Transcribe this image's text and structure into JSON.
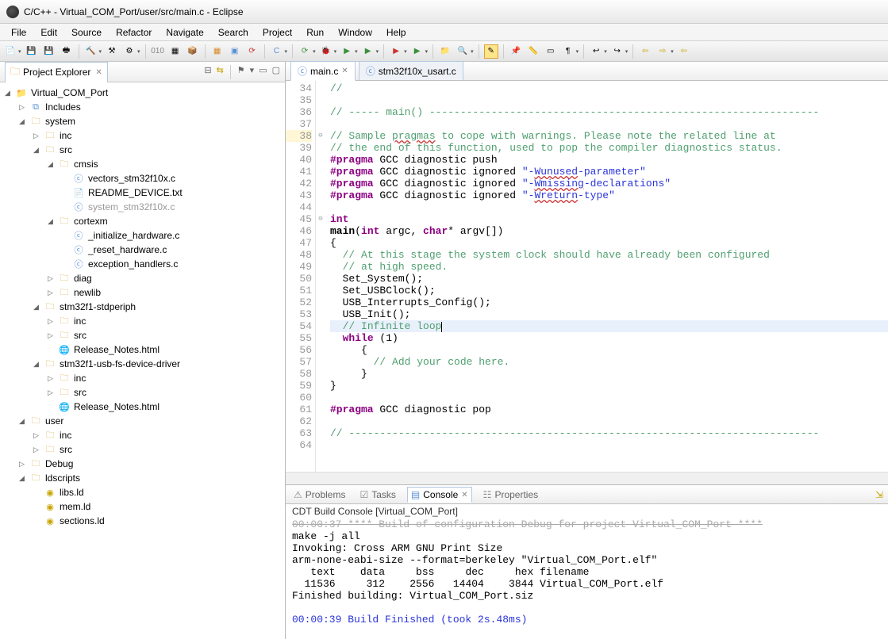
{
  "window": {
    "title": "C/C++ - Virtual_COM_Port/user/src/main.c - Eclipse"
  },
  "menu": [
    "File",
    "Edit",
    "Source",
    "Refactor",
    "Navigate",
    "Search",
    "Project",
    "Run",
    "Window",
    "Help"
  ],
  "project_explorer": {
    "label": "Project Explorer",
    "tree": [
      {
        "d": 0,
        "t": "open",
        "i": "proj",
        "n": "Virtual_COM_Port"
      },
      {
        "d": 1,
        "t": "closed",
        "i": "inc",
        "n": "Includes"
      },
      {
        "d": 1,
        "t": "open",
        "i": "folder",
        "n": "system"
      },
      {
        "d": 2,
        "t": "closed",
        "i": "folder",
        "n": "inc"
      },
      {
        "d": 2,
        "t": "open",
        "i": "folder",
        "n": "src"
      },
      {
        "d": 3,
        "t": "open",
        "i": "folder",
        "n": "cmsis"
      },
      {
        "d": 4,
        "t": "leaf",
        "i": "c",
        "n": "vectors_stm32f10x.c"
      },
      {
        "d": 4,
        "t": "leaf",
        "i": "txt",
        "n": "README_DEVICE.txt"
      },
      {
        "d": 4,
        "t": "leaf",
        "i": "c",
        "n": "system_stm32f10x.c",
        "dim": true
      },
      {
        "d": 3,
        "t": "open",
        "i": "folder",
        "n": "cortexm"
      },
      {
        "d": 4,
        "t": "leaf",
        "i": "c",
        "n": "_initialize_hardware.c"
      },
      {
        "d": 4,
        "t": "leaf",
        "i": "c",
        "n": "_reset_hardware.c"
      },
      {
        "d": 4,
        "t": "leaf",
        "i": "c",
        "n": "exception_handlers.c"
      },
      {
        "d": 3,
        "t": "closed",
        "i": "folder",
        "n": "diag"
      },
      {
        "d": 3,
        "t": "closed",
        "i": "folder",
        "n": "newlib"
      },
      {
        "d": 2,
        "t": "open",
        "i": "folder",
        "n": "stm32f1-stdperiph"
      },
      {
        "d": 3,
        "t": "closed",
        "i": "folder",
        "n": "inc"
      },
      {
        "d": 3,
        "t": "closed",
        "i": "folder",
        "n": "src"
      },
      {
        "d": 3,
        "t": "leaf",
        "i": "html",
        "n": "Release_Notes.html"
      },
      {
        "d": 2,
        "t": "open",
        "i": "folder",
        "n": "stm32f1-usb-fs-device-driver"
      },
      {
        "d": 3,
        "t": "closed",
        "i": "folder",
        "n": "inc"
      },
      {
        "d": 3,
        "t": "closed",
        "i": "folder",
        "n": "src"
      },
      {
        "d": 3,
        "t": "leaf",
        "i": "html",
        "n": "Release_Notes.html"
      },
      {
        "d": 1,
        "t": "open",
        "i": "folder",
        "n": "user"
      },
      {
        "d": 2,
        "t": "closed",
        "i": "folder",
        "n": "inc"
      },
      {
        "d": 2,
        "t": "closed",
        "i": "folder",
        "n": "src"
      },
      {
        "d": 1,
        "t": "closed",
        "i": "folder",
        "n": "Debug"
      },
      {
        "d": 1,
        "t": "open",
        "i": "folder",
        "n": "ldscripts"
      },
      {
        "d": 2,
        "t": "leaf",
        "i": "ld",
        "n": "libs.ld"
      },
      {
        "d": 2,
        "t": "leaf",
        "i": "ld",
        "n": "mem.ld"
      },
      {
        "d": 2,
        "t": "leaf",
        "i": "ld",
        "n": "sections.ld"
      }
    ]
  },
  "editor": {
    "tabs": [
      {
        "name": "main.c",
        "active": true
      },
      {
        "name": "stm32f10x_usart.c",
        "active": false
      }
    ],
    "first_line": 34,
    "lines": [
      {
        "n": 34,
        "html": "<span class='cm'>//</span>"
      },
      {
        "n": 35,
        "html": ""
      },
      {
        "n": 36,
        "html": "<span class='cm'>// ----- main() ---------------------------------------------------------------</span>"
      },
      {
        "n": 37,
        "html": ""
      },
      {
        "n": 38,
        "fold": "⊖",
        "warn": true,
        "html": "<span class='cm'>// Sample <span class='wavy'>pragmas</span> to cope with warnings. Please note the related line at</span>"
      },
      {
        "n": 39,
        "html": "<span class='cm'>// the end of this function, used to pop the compiler diagnostics status.</span>"
      },
      {
        "n": 40,
        "html": "<span class='kw'>#pragma</span> GCC diagnostic push"
      },
      {
        "n": 41,
        "html": "<span class='kw'>#pragma</span> GCC diagnostic ignored <span class='str'>\"-<span class='wavy'>Wunused</span>-parameter\"</span>"
      },
      {
        "n": 42,
        "html": "<span class='kw'>#pragma</span> GCC diagnostic ignored <span class='str'>\"-<span class='wavy'>Wmissing</span>-declarations\"</span>"
      },
      {
        "n": 43,
        "html": "<span class='kw'>#pragma</span> GCC diagnostic ignored <span class='str'>\"-<span class='wavy'>Wreturn</span>-type\"</span>"
      },
      {
        "n": 44,
        "html": ""
      },
      {
        "n": 45,
        "fold": "⊖",
        "html": "<span class='typ'>int</span>"
      },
      {
        "n": 46,
        "html": "<span class='fn'>main</span>(<span class='typ'>int</span> argc, <span class='typ'>char</span>* argv[])"
      },
      {
        "n": 47,
        "html": "{"
      },
      {
        "n": 48,
        "html": "  <span class='cm'>// At this stage the system clock should have already been configured</span>"
      },
      {
        "n": 49,
        "html": "  <span class='cm'>// at high speed.</span>"
      },
      {
        "n": 50,
        "html": "  Set_System();"
      },
      {
        "n": 51,
        "html": "  Set_USBClock();"
      },
      {
        "n": 52,
        "html": "  USB_Interrupts_Config();"
      },
      {
        "n": 53,
        "html": "  USB_Init();"
      },
      {
        "n": 54,
        "hl": true,
        "html": "  <span class='cm'>// Infinite loop</span><span class='cursor'></span>"
      },
      {
        "n": 55,
        "html": "  <span class='kw'>while</span> (1)"
      },
      {
        "n": 56,
        "html": "     {"
      },
      {
        "n": 57,
        "html": "       <span class='cm'>// Add your code here.</span>"
      },
      {
        "n": 58,
        "html": "     }"
      },
      {
        "n": 59,
        "html": "}"
      },
      {
        "n": 60,
        "html": ""
      },
      {
        "n": 61,
        "html": "<span class='kw'>#pragma</span> GCC diagnostic pop"
      },
      {
        "n": 62,
        "html": ""
      },
      {
        "n": 63,
        "html": "<span class='cm'>// ----------------------------------------------------------------------------</span>"
      },
      {
        "n": 64,
        "html": ""
      }
    ]
  },
  "bottom": {
    "tabs": [
      {
        "name": "Problems",
        "active": false
      },
      {
        "name": "Tasks",
        "active": false
      },
      {
        "name": "Console",
        "active": true
      },
      {
        "name": "Properties",
        "active": false
      }
    ],
    "console_title": "CDT Build Console [Virtual_COM_Port]",
    "console_lines": [
      {
        "cls": "dim strike",
        "text": "00:00:37 **** Build of configuration Debug for project Virtual_COM_Port ****"
      },
      {
        "cls": "",
        "text": "make -j all "
      },
      {
        "cls": "",
        "text": "Invoking: Cross ARM GNU Print Size"
      },
      {
        "cls": "",
        "text": "arm-none-eabi-size --format=berkeley \"Virtual_COM_Port.elf\""
      },
      {
        "cls": "",
        "text": "   text\t   data\t    bss\t    dec\t    hex\tfilename"
      },
      {
        "cls": "",
        "text": "  11536\t    312\t   2556\t  14404\t   3844\tVirtual_COM_Port.elf"
      },
      {
        "cls": "",
        "text": "Finished building: Virtual_COM_Port.siz"
      },
      {
        "cls": "",
        "text": " "
      },
      {
        "cls": "",
        "text": ""
      },
      {
        "cls": "blue",
        "text": "00:00:39 Build Finished (took 2s.48ms)"
      }
    ]
  }
}
